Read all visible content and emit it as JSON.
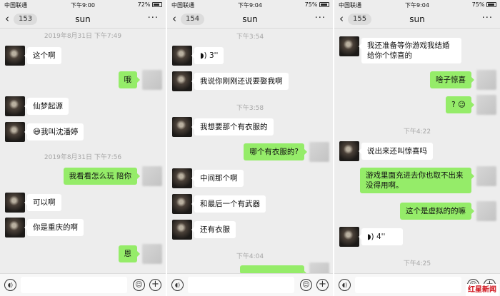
{
  "panels": [
    {
      "status": {
        "carrier": "中国联通",
        "time": "下午9:00",
        "battery": "72%"
      },
      "back_count": "153",
      "title": "sun",
      "messages": [
        {
          "type": "time",
          "text": "2019年8月31日 下午7:49"
        },
        {
          "type": "left",
          "text": "这个啊"
        },
        {
          "type": "right",
          "text": "哦"
        },
        {
          "type": "left",
          "text": "仙梦起源"
        },
        {
          "type": "left",
          "text": "我叫沈潘婷",
          "emoji": true
        },
        {
          "type": "time",
          "text": "2019年8月31日 下午7:56"
        },
        {
          "type": "right",
          "text": "我看看怎么玩 陪你"
        },
        {
          "type": "left",
          "text": "可以啊"
        },
        {
          "type": "left",
          "text": "你是重庆的啊"
        },
        {
          "type": "right",
          "text": "恩"
        }
      ]
    },
    {
      "status": {
        "carrier": "中国联通",
        "time": "下午9:04",
        "battery": "75%"
      },
      "back_count": "154",
      "title": "sun",
      "messages": [
        {
          "type": "time",
          "text": "下午3:54"
        },
        {
          "type": "left",
          "text": "3''",
          "voice": true
        },
        {
          "type": "left",
          "text": "我说你刚刚还说要娶我啊"
        },
        {
          "type": "time",
          "text": "下午3:58"
        },
        {
          "type": "left",
          "text": "我想要那个有衣服的"
        },
        {
          "type": "right",
          "text": "哪个有衣服的?"
        },
        {
          "type": "left",
          "text": "中间那个啊"
        },
        {
          "type": "left",
          "text": "和最后一个有武器"
        },
        {
          "type": "left",
          "text": "还有衣服"
        },
        {
          "type": "time",
          "text": "下午4:04"
        }
      ]
    },
    {
      "status": {
        "carrier": "中国联通",
        "time": "下午9:04",
        "battery": "75%"
      },
      "back_count": "155",
      "title": "sun",
      "messages": [
        {
          "type": "left",
          "text": "我还准备等你游戏我结婚给你个惊喜的",
          "lines": 2
        },
        {
          "type": "right",
          "text": "啥子惊喜"
        },
        {
          "type": "right",
          "text": "?",
          "emoji": true
        },
        {
          "type": "time",
          "text": "下午4:22"
        },
        {
          "type": "left",
          "text": "说出来还叫惊喜吗"
        },
        {
          "type": "right",
          "text": "游戏里面充进去你也取不出来没得用啊。",
          "lines": 2
        },
        {
          "type": "right",
          "text": "这个是虚拟的的嘛"
        },
        {
          "type": "left",
          "text": "4''",
          "voice": true
        },
        {
          "type": "time",
          "text": "下午4:25"
        }
      ]
    }
  ],
  "watermark": "红星新闻",
  "icons": {
    "back": "chevron-left-icon",
    "more": "more-dots-icon",
    "voice": "voice-icon",
    "emoji": "emoji-icon",
    "plus": "plus-icon"
  }
}
